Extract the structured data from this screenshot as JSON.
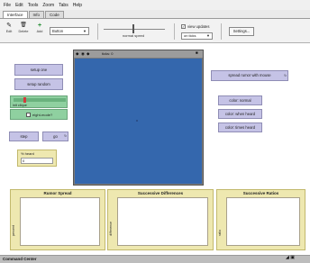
{
  "menu": [
    "File",
    "Edit",
    "Tools",
    "Zoom",
    "Tabs",
    "Help"
  ],
  "tabs": [
    {
      "label": "Interface",
      "active": true
    },
    {
      "label": "Info",
      "active": false
    },
    {
      "label": "Code",
      "active": false
    }
  ],
  "toolbar": {
    "tools": [
      {
        "label": "Edit",
        "icon": "pencil-icon",
        "glyph": "✎"
      },
      {
        "label": "Delete",
        "icon": "trash-icon",
        "glyph": "🗑"
      },
      {
        "label": "Add",
        "icon": "plus-icon",
        "glyph": "+"
      }
    ],
    "widget_type": "Button",
    "speed_label": "normal speed",
    "view_updates_label": "view updates",
    "view_updates_checked": true,
    "update_mode": "on ticks",
    "settings_label": "Settings..."
  },
  "buttons": {
    "setup_one": "setup one",
    "setup_random": "setup random",
    "step": "step",
    "go": "go",
    "spread_rumor": "spread rumor with mouse",
    "color_normal": "color: normal",
    "color_when_heard": "color: when heard",
    "color_times_heard": "color: times heard"
  },
  "switch": {
    "label": "init clique"
  },
  "chooser": {
    "label": "eight-mode?"
  },
  "monitor": {
    "title": "% heard",
    "value": "0"
  },
  "view": {
    "title": "ticks: 0",
    "controls": [
      "◆",
      "◉",
      "◆"
    ],
    "close": "■"
  },
  "plots": [
    {
      "title": "Rumor Spread",
      "ylabel": "percent"
    },
    {
      "title": "Successive Differences",
      "ylabel": "difference"
    },
    {
      "title": "Successive Ratios",
      "ylabel": "ratio"
    }
  ],
  "command_center": {
    "label": "Command Center",
    "icons": "◢ ▣"
  },
  "colors": {
    "button": "#c5c3e6",
    "switch": "#8fd0a0",
    "monitor": "#eee8b0",
    "world": "#3467ad"
  }
}
